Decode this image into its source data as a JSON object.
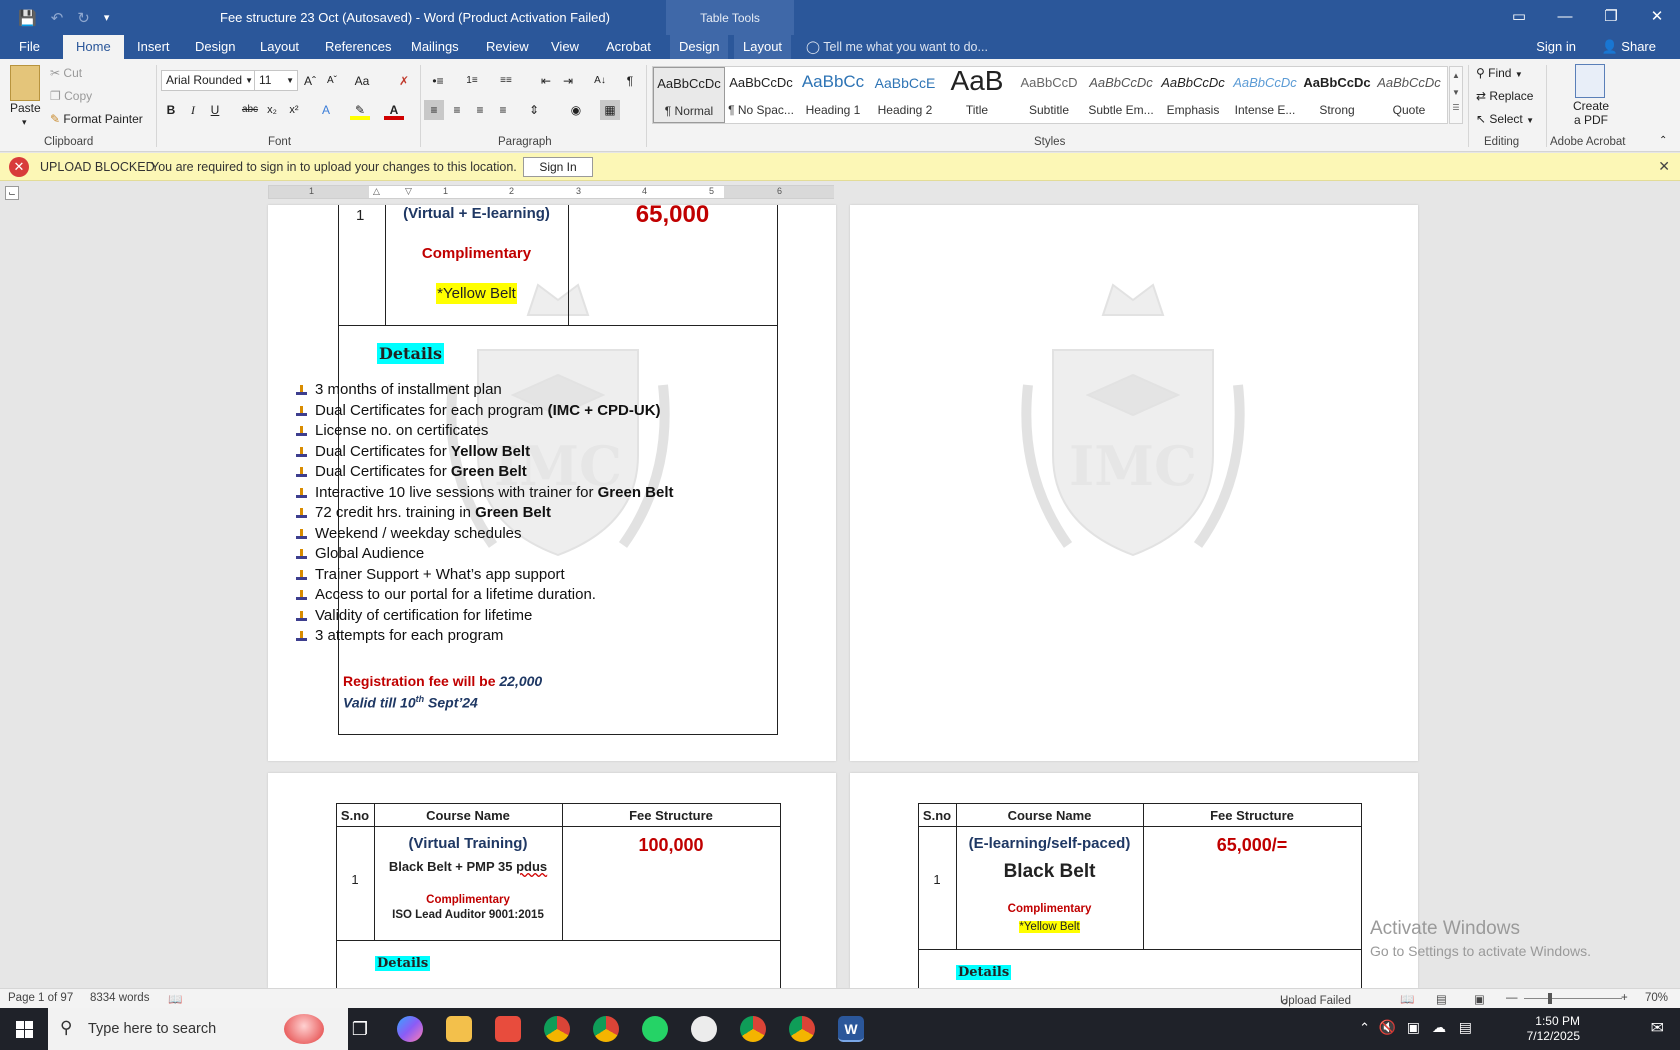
{
  "window": {
    "title": "Fee structure 23 Oct (Autosaved) - Word (Product Activation Failed)",
    "contextual_tab_group": "Table Tools",
    "buttons": [
      "▭",
      "—",
      "❐",
      "✕"
    ]
  },
  "tabs": [
    "File",
    "Home",
    "Insert",
    "Design",
    "Layout",
    "References",
    "Mailings",
    "Review",
    "View",
    "Acrobat",
    "Design",
    "Layout"
  ],
  "tell_me": "Tell me what you want to do...",
  "sign_in": "Sign in",
  "share": "Share",
  "clipboard": {
    "paste": "Paste",
    "cut": "Cut",
    "copy": "Copy",
    "format_painter": "Format Painter",
    "label": "Clipboard"
  },
  "font": {
    "name": "Arial Rounded",
    "size": "11",
    "label": "Font"
  },
  "paragraph": {
    "label": "Paragraph"
  },
  "styles": {
    "label": "Styles",
    "items": [
      {
        "sample": "AaBbCcDc",
        "name": "¶ Normal",
        "color": "#222222"
      },
      {
        "sample": "AaBbCcDc",
        "name": "¶ No Spac...",
        "color": "#222222"
      },
      {
        "sample": "AaBbCc",
        "name": "Heading 1",
        "color": "#2e74b5"
      },
      {
        "sample": "AaBbCcE",
        "name": "Heading 2",
        "color": "#2e74b5"
      },
      {
        "sample": "AaB",
        "name": "Title",
        "color": "#222222"
      },
      {
        "sample": "AaBbCcD",
        "name": "Subtitle",
        "color": "#666666"
      },
      {
        "sample": "AaBbCcDc",
        "name": "Subtle Em...",
        "color": "#555555"
      },
      {
        "sample": "AaBbCcDc",
        "name": "Emphasis",
        "color": "#333333"
      },
      {
        "sample": "AaBbCcDc",
        "name": "Intense E...",
        "color": "#5b9bd5"
      },
      {
        "sample": "AaBbCcDc",
        "name": "Strong",
        "color": "#111111"
      },
      {
        "sample": "AaBbCcDc",
        "name": "Quote",
        "color": "#555555"
      }
    ]
  },
  "editing": {
    "find": "Find",
    "replace": "Replace",
    "select": "Select",
    "label": "Editing"
  },
  "acrobat": {
    "create_pdf_line1": "Create",
    "create_pdf_line2": "a PDF",
    "label": "Adobe Acrobat"
  },
  "message_bar": {
    "title": "UPLOAD BLOCKED",
    "text": "You are required to sign in to upload your changes to this location.",
    "button": "Sign In"
  },
  "ruler_numbers": [
    "1",
    "1",
    "2",
    "3",
    "4",
    "5",
    "6"
  ],
  "page1": {
    "sno": "1",
    "course": "(Virtual + E-learning)",
    "complimentary": "Complimentary",
    "belt": "*Yellow Belt",
    "fee": "65,000",
    "details_title": "Details",
    "details": [
      {
        "text": "3 months of installment plan",
        "bold": ""
      },
      {
        "text": "Dual Certificates for each program ",
        "bold": "(IMC + CPD-UK)"
      },
      {
        "text": "License no. on certificates",
        "bold": ""
      },
      {
        "text": "Dual Certificates for ",
        "bold": "Yellow Belt"
      },
      {
        "text": "Dual Certificates for ",
        "bold": "Green Belt"
      },
      {
        "text": "Interactive 10 live sessions with trainer for ",
        "bold": "Green Belt"
      },
      {
        "text": "72 credit hrs. training in ",
        "bold": "Green Belt"
      },
      {
        "text": "Weekend / weekday schedules",
        "bold": ""
      },
      {
        "text": "Global Audience",
        "bold": ""
      },
      {
        "text": "Trainer Support + What’s app support",
        "bold": ""
      },
      {
        "text": "Access to our portal for a lifetime duration.",
        "bold": ""
      },
      {
        "text": "Validity of certification for lifetime",
        "bold": ""
      },
      {
        "text": "3 attempts for each program",
        "bold": ""
      }
    ],
    "reg_fee_label": "Registration fee will be ",
    "reg_fee_value": "22,000",
    "valid_prefix": "Valid till 10",
    "valid_sup": "th",
    "valid_suffix": " Sept’24"
  },
  "table_headers": {
    "sno": "S.no",
    "course": "Course Name",
    "fee": "Fee Structure"
  },
  "page3": {
    "sno": "1",
    "course_type": "(Virtual Training)",
    "course_name": "Black Belt + PMP 35 ",
    "course_name_underlined": "pdus",
    "complimentary": "Complimentary",
    "extra": "ISO Lead Auditor 9001:2015",
    "fee": "100,000",
    "details_title": "Details"
  },
  "page4": {
    "sno": "1",
    "course_type": "(E-learning/self-paced)",
    "course_name": "Black Belt",
    "complimentary": "Complimentary",
    "belt": "*Yellow Belt",
    "fee": "65,000/=",
    "details_title": "Details"
  },
  "watermark_text": "IMC",
  "activate": {
    "line1": "Activate Windows",
    "line2": "Go to Settings to activate Windows."
  },
  "status": {
    "page": "Page 1 of 97",
    "words": "8334 words",
    "upload": "Upload Failed",
    "zoom": "70%"
  },
  "taskbar": {
    "search_placeholder": "Type here to search",
    "time": "1:50 PM",
    "date": "7/12/2025"
  }
}
